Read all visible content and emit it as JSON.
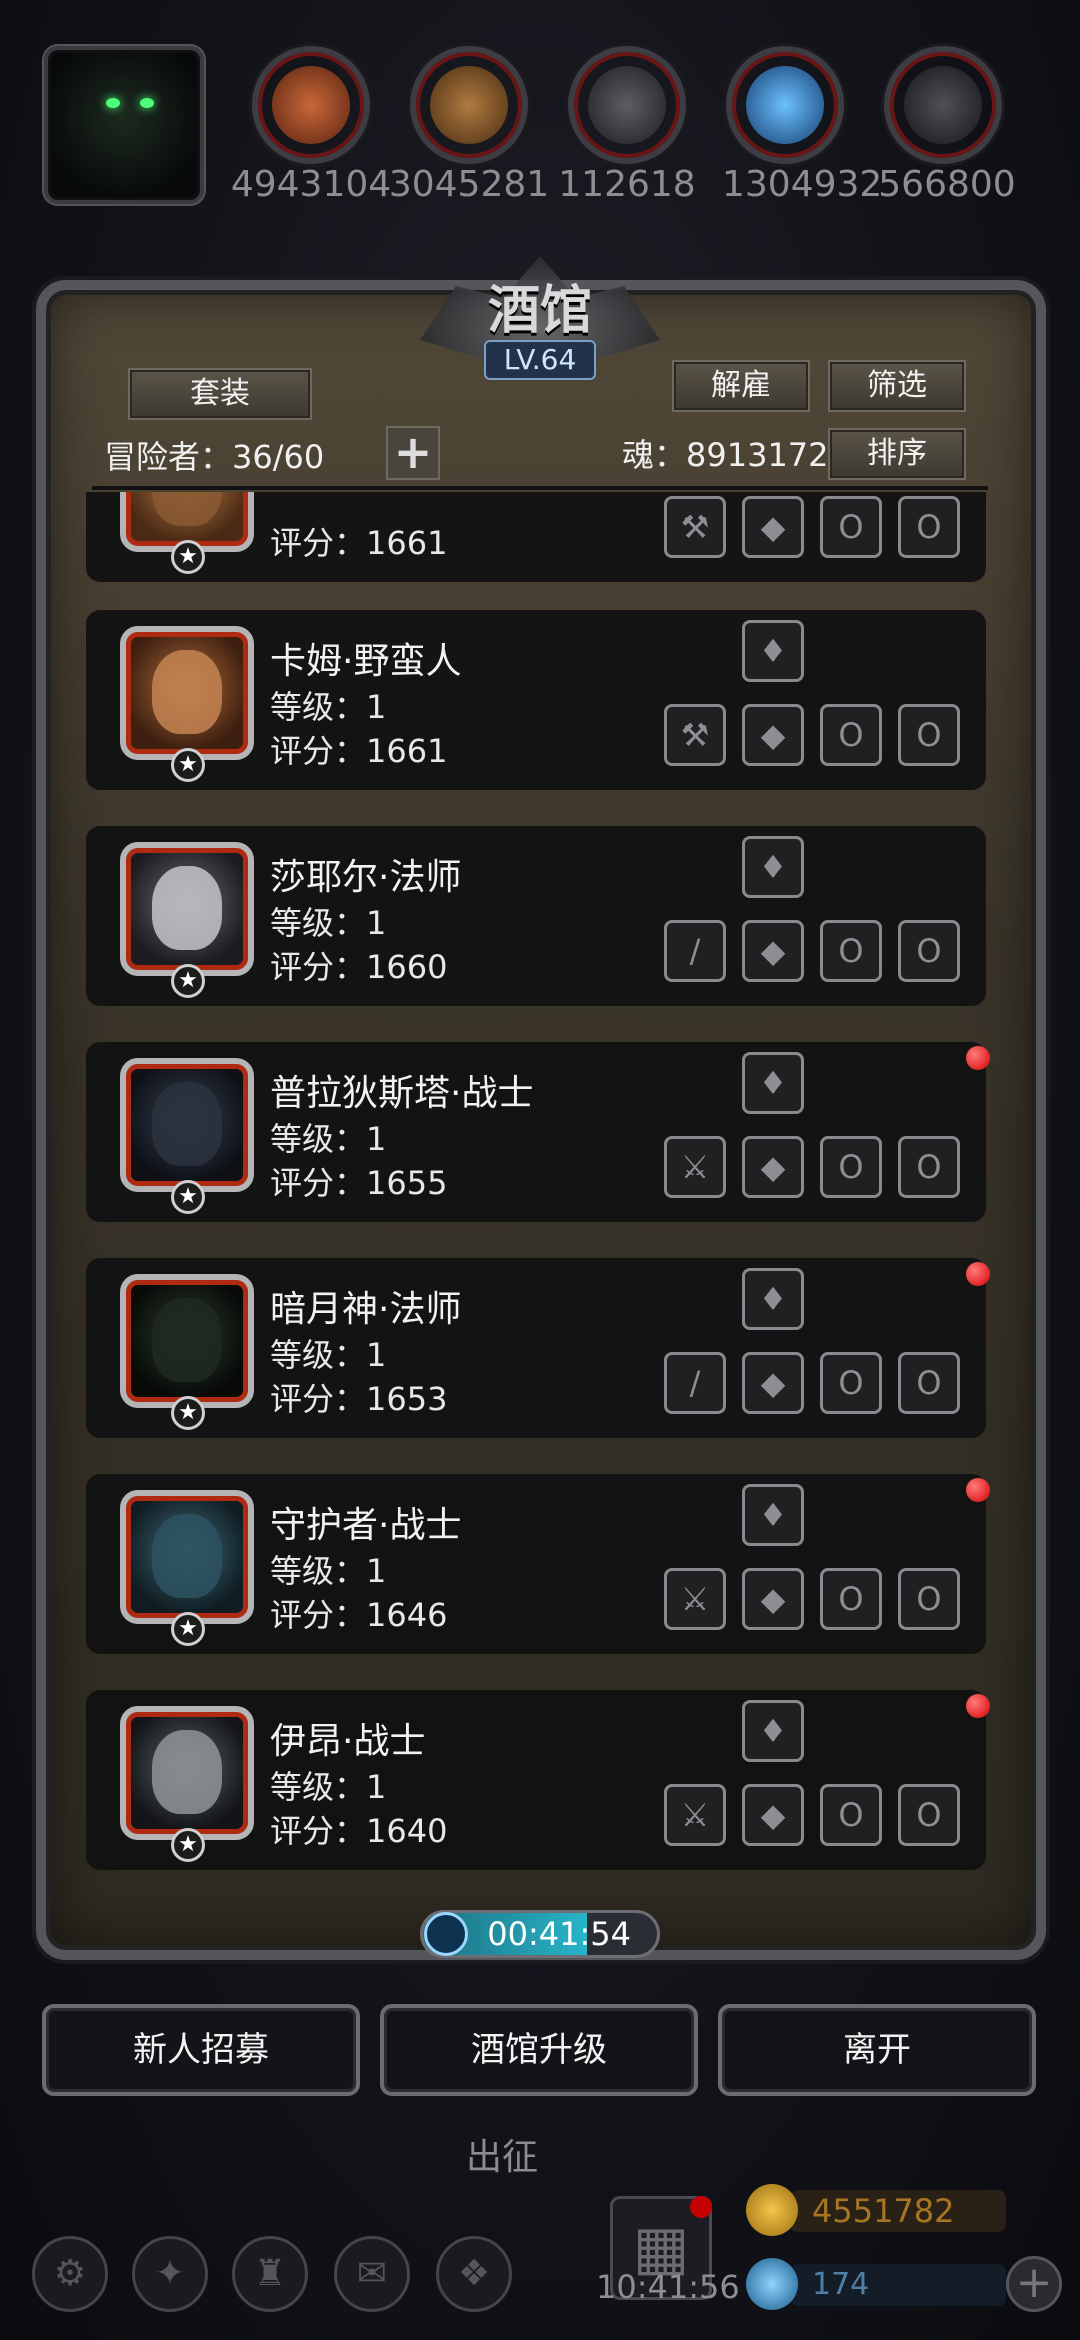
{
  "resources": [
    {
      "value": "4943104",
      "icon": "meat-icon",
      "color": "#b4532a"
    },
    {
      "value": "3045281",
      "icon": "wood-icon",
      "color": "#9a6a36"
    },
    {
      "value": "112618",
      "icon": "iron-icon",
      "color": "#4a4a4e"
    },
    {
      "value": "1304932",
      "icon": "crystal-icon",
      "color": "#3a8ad0"
    },
    {
      "value": "566800",
      "icon": "stone-icon",
      "color": "#3e3e42"
    }
  ],
  "tavern": {
    "title": "酒馆",
    "level": "LV.64",
    "set_button": "套装",
    "dismiss_button": "解雇",
    "filter_button": "筛选",
    "sort_button": "排序",
    "adventurers_label": "冒险者：36/60",
    "souls_label": "魂：8913172",
    "plus": "+"
  },
  "heroes": [
    {
      "name": "",
      "level": "",
      "score": "评分：1661",
      "weapon": "axe-icon",
      "alert": false
    },
    {
      "name": "卡姆·野蛮人",
      "level": "等级：1",
      "score": "评分：1661",
      "weapon": "axe-icon",
      "alert": false
    },
    {
      "name": "莎耶尔·法师",
      "level": "等级：1",
      "score": "评分：1660",
      "weapon": "staff-icon",
      "alert": false
    },
    {
      "name": "普拉狄斯塔·战士",
      "level": "等级：1",
      "score": "评分：1655",
      "weapon": "sword-icon",
      "alert": true
    },
    {
      "name": "暗月神·法师",
      "level": "等级：1",
      "score": "评分：1653",
      "weapon": "staff-icon",
      "alert": true
    },
    {
      "name": "守护者·战士",
      "level": "等级：1",
      "score": "评分：1646",
      "weapon": "sword-icon",
      "alert": true
    },
    {
      "name": "伊昂·战士",
      "level": "等级：1",
      "score": "评分：1640",
      "weapon": "sword-icon",
      "alert": true
    }
  ],
  "star": "★",
  "timer": "00:41:54",
  "actions": {
    "recruit": "新人招募",
    "upgrade": "酒馆升级",
    "leave": "离开"
  },
  "depart": "出征",
  "clock": "10:41:56",
  "gold": "4551782",
  "gems": "174",
  "add": "+"
}
